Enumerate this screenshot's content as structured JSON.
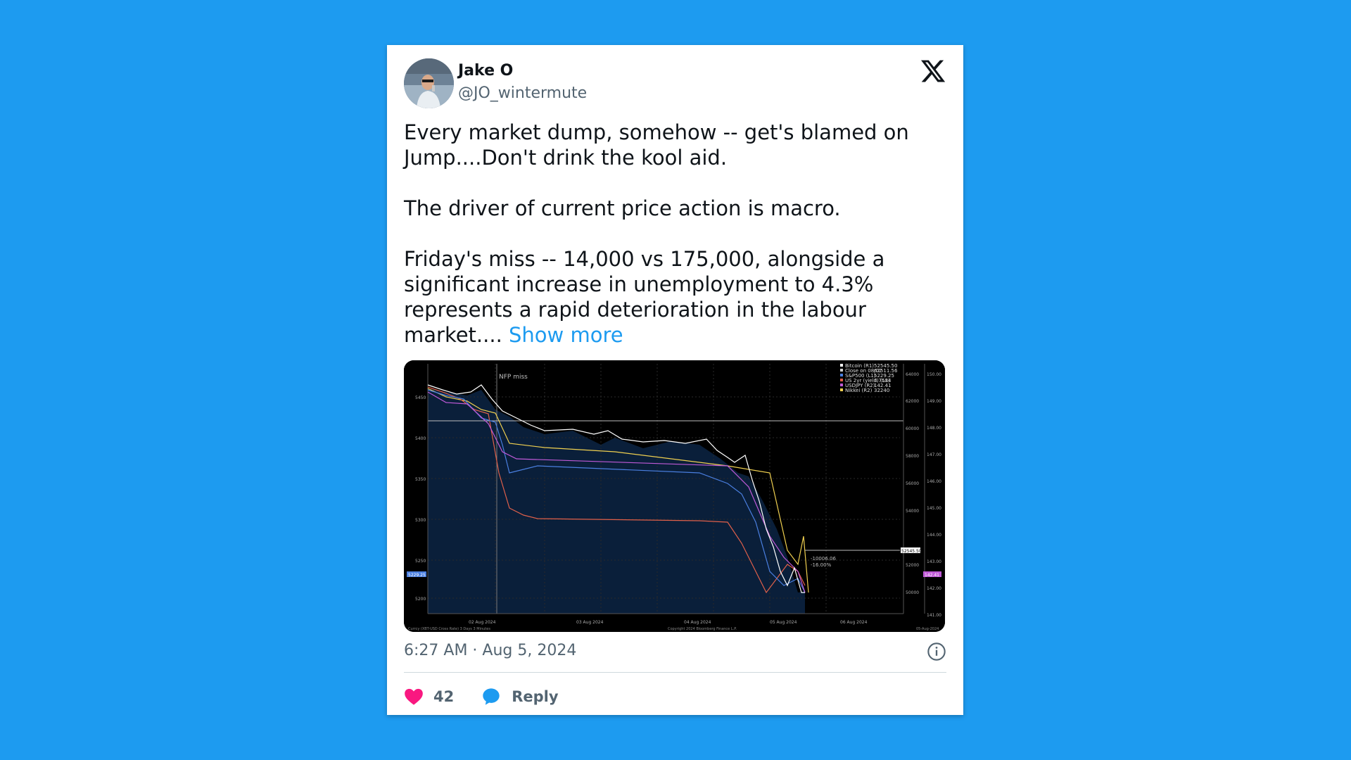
{
  "tweet": {
    "author_name": "Jake O",
    "author_handle": "@JO_wintermute",
    "paragraphs": [
      "Every market dump, somehow -- get's blamed on Jump....Don't drink the kool aid.",
      "The driver of current price action is macro."
    ],
    "last_paragraph": "Friday's miss  -- 14,000 vs 175,000, alongside a significant increase in unemployment to 4.3% represents a rapid deterioration in the labour market....",
    "show_more": "Show more",
    "timestamp": "6:27 AM · Aug 5, 2024",
    "likes": "42",
    "reply_label": "Reply"
  },
  "icons": {
    "logo": "x-logo-icon",
    "info": "info-icon",
    "like": "heart-icon",
    "reply": "speech-bubble-icon"
  },
  "colors": {
    "background": "#1d9bf0",
    "heart": "#f91880",
    "reply": "#1d9bf0",
    "link": "#1d9bf0"
  },
  "chart": {
    "annotation": "NFP miss",
    "legend": [
      {
        "label": "Bitcoin (R1)",
        "value": "52545.50",
        "color": "#ffffff"
      },
      {
        "label": "Close on 08/02",
        "value": "62511.56",
        "color": "#cfcfcf"
      },
      {
        "label": "S&P500 (L1)",
        "value": "5229.25",
        "color": "#4a7fe0"
      },
      {
        "label": "US 2yr (yield) (L1)",
        "value": "3.7584",
        "color": "#e0604a"
      },
      {
        "label": "USDJPY (R2)",
        "value": "142.41",
        "color": "#c05ad8"
      },
      {
        "label": "Nikkei (R2)",
        "value": "32240",
        "color": "#f0d050"
      }
    ],
    "left_ticks": [
      "5450",
      "5400",
      "5350",
      "5300",
      "5250",
      "5200"
    ],
    "right_ticks_1": [
      "64000",
      "62000",
      "60000",
      "58000",
      "56000",
      "54000",
      "52000",
      "50000"
    ],
    "right_ticks_2": [
      "150.00",
      "149.00",
      "148.00",
      "147.00",
      "146.00",
      "145.00",
      "144.00",
      "143.00",
      "142.00",
      "141.00"
    ],
    "date_labels": [
      "02 Aug 2024",
      "03 Aug 2024",
      "04 Aug 2024",
      "05 Aug 2024",
      "06 Aug 2024"
    ],
    "footer_left": "Currcy (XBT-USD Cross Rate) 3 Days 3 Minutes",
    "footer_center": "Copyright 2024 Bloomberg Finance L.P.",
    "footer_right": "05-Aug-2024",
    "tag_left": "5229.25",
    "tag_right": "52545.50",
    "tag_right2": "142.41",
    "drop_label_1": "-10006.06",
    "drop_label_2": "-16.00%"
  }
}
